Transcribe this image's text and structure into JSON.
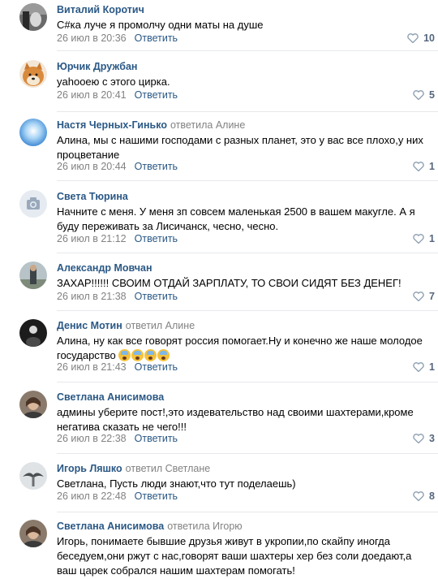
{
  "reply_label": "Ответить",
  "comments": [
    {
      "author": "Виталий Коротич",
      "reply_to": "",
      "text": "С#ка луче я промолчу одни маты на душе",
      "date": "26 июл в 20:36",
      "likes": "10",
      "avatar": "avatar-bw-portrait"
    },
    {
      "author": "Юрчик Дружбан",
      "reply_to": "",
      "text": "yahooею с этого цирка.",
      "date": "26 июл в 20:41",
      "likes": "5",
      "avatar": "avatar-shiba-dog"
    },
    {
      "author": "Настя Черных-Гинько",
      "reply_to": "ответила Алине",
      "text": "Алина, мы с нашими господами с разных планет, это у вас все плохо,у них процветание",
      "date": "26 июл в 20:44",
      "likes": "1",
      "avatar": "avatar-blue-sky"
    },
    {
      "author": "Света Тюрина",
      "reply_to": "",
      "text": "Начните с меня. У меня зп совсем маленькая 2500 в вашем макугле. А я буду переживать за Лисичанск, чесно, чесно.",
      "date": "26 июл в 21:12",
      "likes": "1",
      "avatar": "camera-placeholder-icon"
    },
    {
      "author": "Александр Мовчан",
      "reply_to": "",
      "text": "ЗАХАР!!!!!! СВОИМ ОТДАЙ ЗАРПЛАТУ, ТО СВОИ СИДЯТ БЕЗ ДЕНЕГ!",
      "date": "26 июл в 21:38",
      "likes": "7",
      "avatar": "avatar-man-outdoor"
    },
    {
      "author": "Денис Мотин",
      "reply_to": "ответил Алине",
      "text": "Алина, ну как все говорят россия помогает.Ну и конечно же наше молодое государство",
      "emoji_count": 4,
      "date": "26 июл в 21:43",
      "likes": "1",
      "avatar": "avatar-dark-photo"
    },
    {
      "author": "Светлана Анисимова",
      "reply_to": "",
      "text": "админы уберите пост!,это издевательство над своими шахтерами,кроме негатива сказать не чего!!!",
      "date": "26 июл в 22:38",
      "likes": "3",
      "avatar": "avatar-woman-portrait"
    },
    {
      "author": "Игорь Ляшко",
      "reply_to": "ответил Светлане",
      "text": "Светлана, Пусть люди знают,что тут поделаешь)",
      "date": "26 июл в 22:48",
      "likes": "8",
      "avatar": "avatar-bird-sky"
    },
    {
      "author": "Светлана Анисимова",
      "reply_to": "ответила Игорю",
      "text": "Игорь, понимаете бывшие друзья живут в укропии,по скайпу иногда беседуем,они ржут с нас,говорят ваши шахтеры хер без соли доедают,а ваш царек собрался нашим шахтерам помогать!",
      "date": "",
      "likes": "",
      "avatar": "avatar-woman-portrait"
    }
  ],
  "colors": {
    "link": "#2a5885",
    "meta": "#828282",
    "separator": "#e7e8ec"
  }
}
